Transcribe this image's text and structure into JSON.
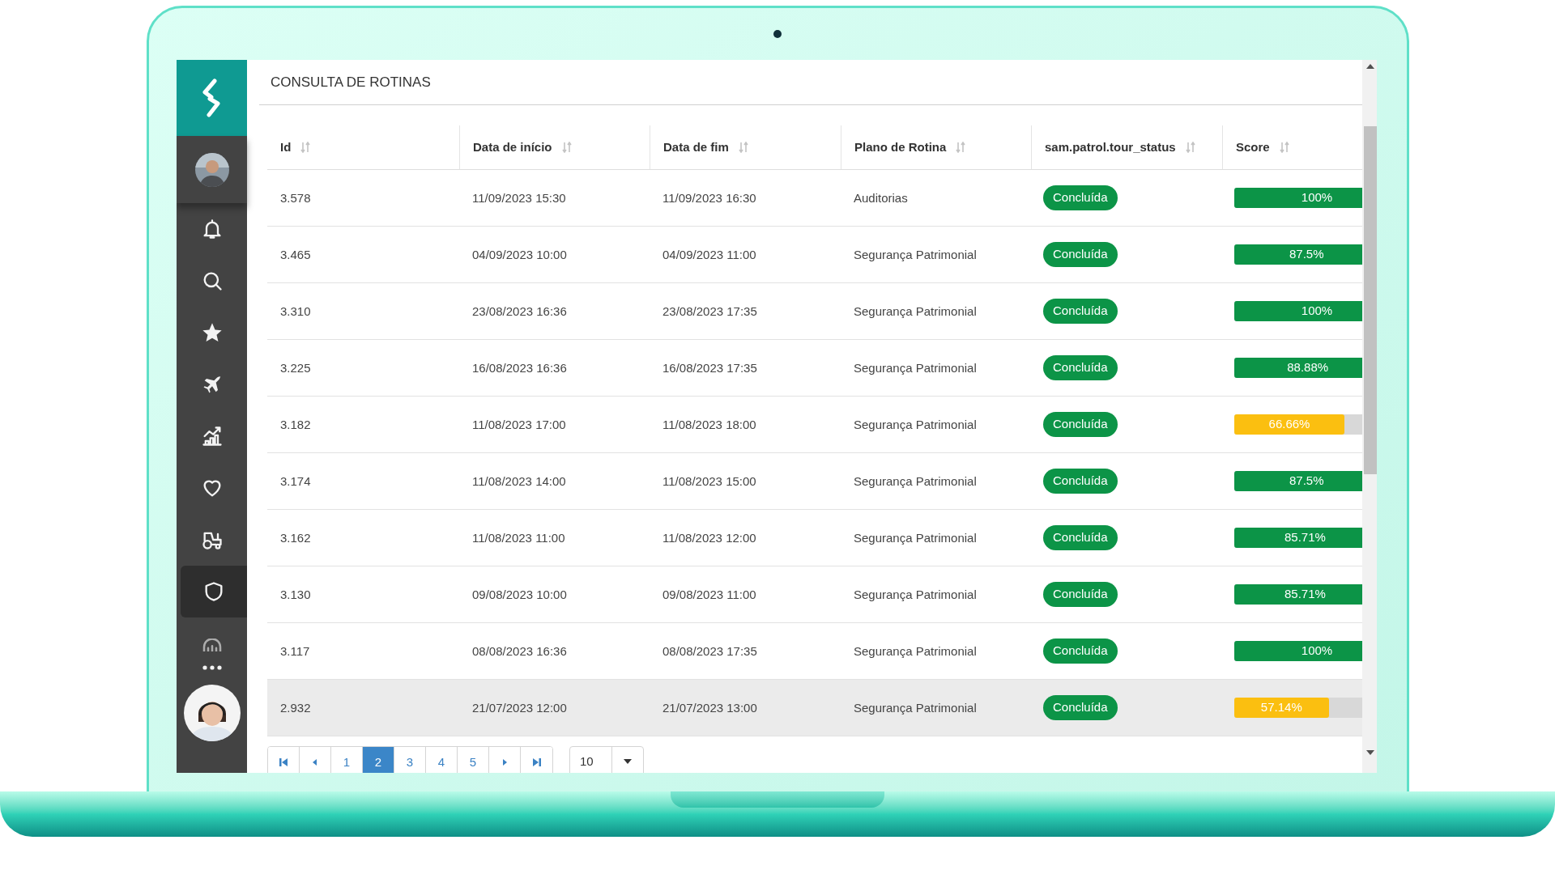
{
  "sidebar": {
    "items": [
      {
        "selected": false
      },
      {
        "selected": false
      },
      {
        "selected": false
      },
      {
        "selected": false
      },
      {
        "selected": false
      },
      {
        "selected": false
      },
      {
        "selected": false
      },
      {
        "selected": false
      },
      {
        "selected": true
      },
      {
        "selected": false
      }
    ]
  },
  "page": {
    "title": "CONSULTA DE ROTINAS"
  },
  "table": {
    "columns": [
      "Id",
      "Data de início",
      "Data de fim",
      "Plano de Rotina",
      "sam.patrol.tour_status",
      "Score"
    ],
    "rows": [
      {
        "id": "3.578",
        "start": "11/09/2023 15:30",
        "end": "11/09/2023 16:30",
        "plan": "Auditorias",
        "status": "Concluída",
        "score": "100%",
        "level": 1,
        "selected": false
      },
      {
        "id": "3.465",
        "start": "04/09/2023 10:00",
        "end": "04/09/2023 11:00",
        "plan": "Segurança Patrimonial",
        "status": "Concluída",
        "score": "87.5%",
        "level": 0.875,
        "selected": false
      },
      {
        "id": "3.310",
        "start": "23/08/2023 16:36",
        "end": "23/08/2023 17:35",
        "plan": "Segurança Patrimonial",
        "status": "Concluída",
        "score": "100%",
        "level": 1,
        "selected": false
      },
      {
        "id": "3.225",
        "start": "16/08/2023 16:36",
        "end": "16/08/2023 17:35",
        "plan": "Segurança Patrimonial",
        "status": "Concluída",
        "score": "88.88%",
        "level": 0.8888,
        "selected": false
      },
      {
        "id": "3.182",
        "start": "11/08/2023 17:00",
        "end": "11/08/2023 18:00",
        "plan": "Segurança Patrimonial",
        "status": "Concluída",
        "score": "66.66%",
        "level": 0.6666,
        "selected": false
      },
      {
        "id": "3.174",
        "start": "11/08/2023 14:00",
        "end": "11/08/2023 15:00",
        "plan": "Segurança Patrimonial",
        "status": "Concluída",
        "score": "87.5%",
        "level": 0.875,
        "selected": false
      },
      {
        "id": "3.162",
        "start": "11/08/2023 11:00",
        "end": "11/08/2023 12:00",
        "plan": "Segurança Patrimonial",
        "status": "Concluída",
        "score": "85.71%",
        "level": 0.8571,
        "selected": false
      },
      {
        "id": "3.130",
        "start": "09/08/2023 10:00",
        "end": "09/08/2023 11:00",
        "plan": "Segurança Patrimonial",
        "status": "Concluída",
        "score": "85.71%",
        "level": 0.8571,
        "selected": false
      },
      {
        "id": "3.117",
        "start": "08/08/2023 16:36",
        "end": "08/08/2023 17:35",
        "plan": "Segurança Patrimonial",
        "status": "Concluída",
        "score": "100%",
        "level": 1,
        "selected": false
      },
      {
        "id": "2.932",
        "start": "21/07/2023 12:00",
        "end": "21/07/2023 13:00",
        "plan": "Segurança Patrimonial",
        "status": "Concluída",
        "score": "57.14%",
        "level": 0.5714,
        "selected": true
      }
    ]
  },
  "pagination": {
    "pages": [
      {
        "label": "1",
        "selected": false
      },
      {
        "label": "2",
        "selected": true
      },
      {
        "label": "3",
        "selected": false
      },
      {
        "label": "4",
        "selected": false
      },
      {
        "label": "5",
        "selected": false
      }
    ],
    "page_size": "10"
  }
}
